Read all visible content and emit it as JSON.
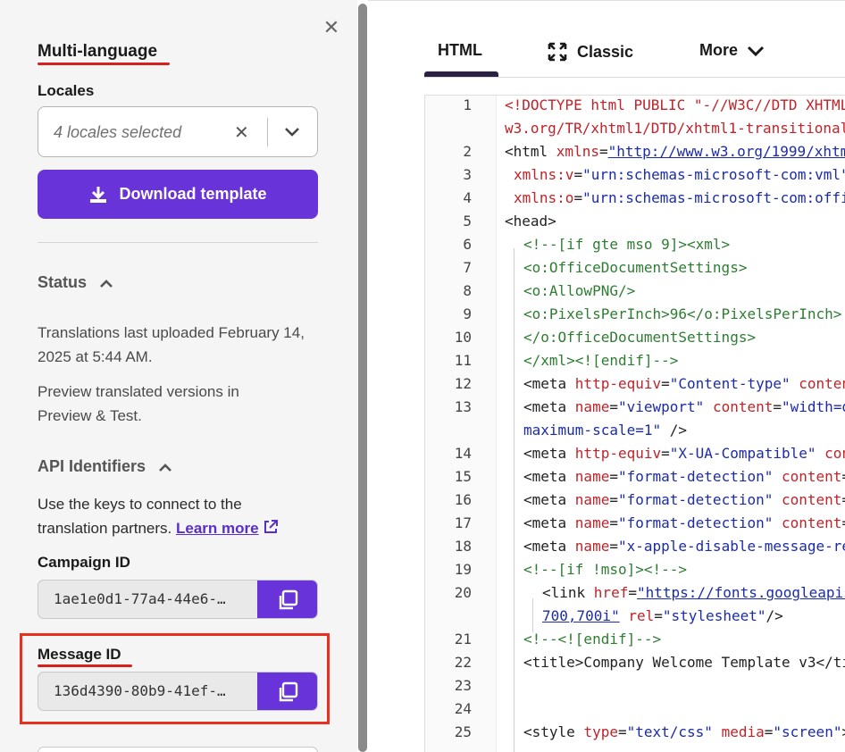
{
  "sidebar": {
    "title": "Multi-language",
    "locales_label": "Locales",
    "locales_placeholder": "4 locales selected",
    "download_button": "Download template",
    "status": {
      "heading": "Status",
      "text1": "Translations last uploaded February 14, 2025 at 5:44 AM.",
      "text2": "Preview translated versions in Preview & Test."
    },
    "api": {
      "heading": "API Identifiers",
      "text": "Use the keys to connect to the translation partners.",
      "learn_more": "Learn more"
    },
    "campaign": {
      "label": "Campaign ID",
      "value": "1ae1e0d1-77a4-44e6-…"
    },
    "message": {
      "label": "Message ID",
      "value": "136d4390-80b9-41ef-…"
    }
  },
  "tabs": {
    "html": "HTML",
    "classic": "Classic",
    "more": "More"
  },
  "editor": {
    "gutter": [
      "1",
      "2",
      "3",
      "4",
      "5",
      "6",
      "7",
      "8",
      "9",
      "10",
      "11",
      "12",
      "13",
      "14",
      "15",
      "16",
      "17",
      "18",
      "19",
      "20",
      "21",
      "22",
      "23",
      "24",
      "25"
    ]
  },
  "colors": {
    "accent": "#6833d8",
    "highlight": "#e8301e",
    "tag": "#c0232a",
    "string": "#1c2ca8",
    "comment": "#2e7d32"
  }
}
